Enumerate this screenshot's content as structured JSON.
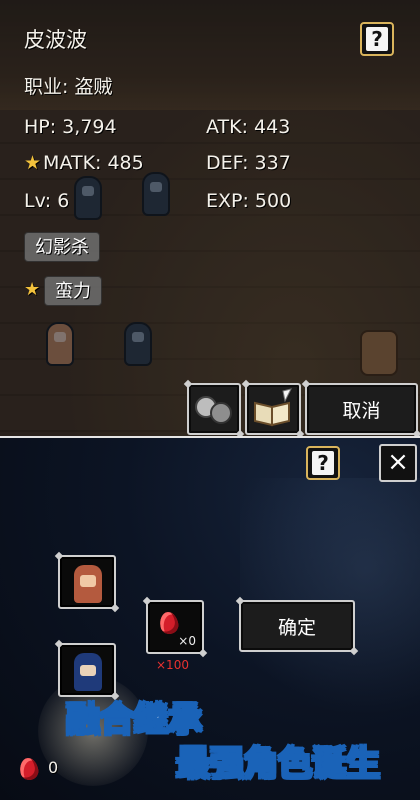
{
  "character": {
    "name": "皮波波",
    "job": "职业: 盗贼",
    "hp": "HP: 3,794",
    "atk": "ATK: 443",
    "matk": "MATK: 485",
    "def": "DEF: 337",
    "lv": "Lv: 6",
    "exp": "EXP: 500"
  },
  "skills": [
    {
      "label": "幻影杀",
      "starred": false
    },
    {
      "label": "蛮力",
      "starred": true
    }
  ],
  "buttons": {
    "help": "?",
    "cancel": "取消",
    "confirm": "确定",
    "close": "×"
  },
  "fusion": {
    "gem_cost": "×0",
    "gem_required": "×100",
    "gem_balance": "0"
  },
  "promo": {
    "line1": "融合继承",
    "line2": "最强角色诞生"
  },
  "icons": {
    "help": "question-icon",
    "orbs": "orbs-icon",
    "book": "book-quill-icon",
    "gem": "red-gem-icon",
    "close": "close-icon",
    "star": "star-icon"
  },
  "colors": {
    "star": "#f3c23c",
    "gem": "#d41e2a",
    "required_text": "#e8312f",
    "promo_outline": "#1a63b8",
    "help_border": "#d9b45c"
  }
}
